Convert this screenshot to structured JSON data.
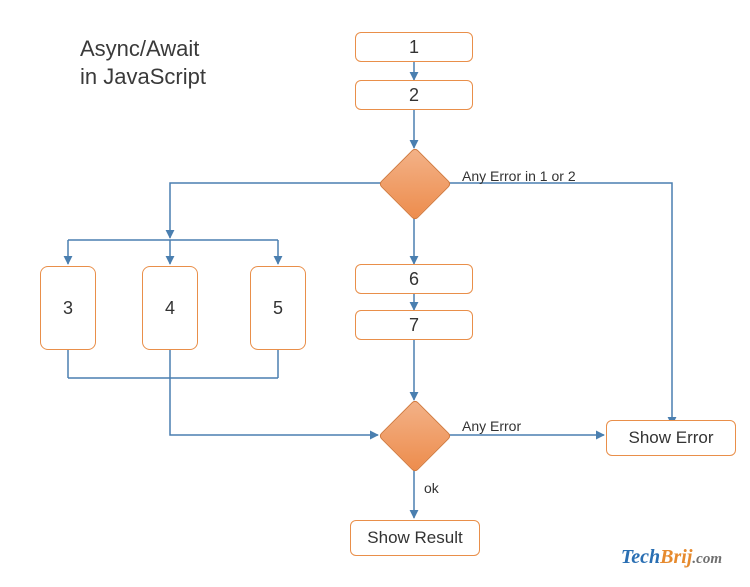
{
  "title_line1": "Async/Await",
  "title_line2": "in JavaScript",
  "nodes": {
    "n1": "1",
    "n2": "2",
    "n3": "3",
    "n4": "4",
    "n5": "5",
    "n6": "6",
    "n7": "7",
    "showResult": "Show Result",
    "showError": "Show Error"
  },
  "labels": {
    "anyError12": "Any Error in 1 or 2",
    "anyError": "Any Error",
    "ok": "ok"
  },
  "brand": {
    "part1": "Tech",
    "part2": "Brij",
    "part3": ".com"
  },
  "colors": {
    "connector": "#4a7fb0",
    "boxBorder": "#e98f4a",
    "diamondFill": "#ed8c4c"
  }
}
